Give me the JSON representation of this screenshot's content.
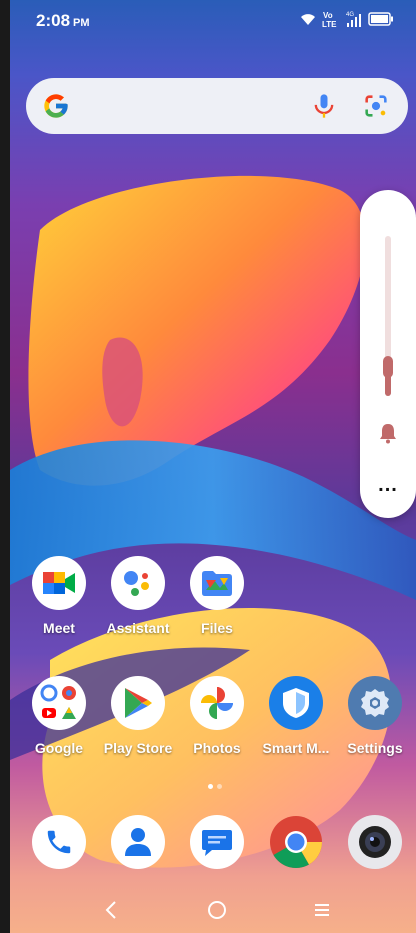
{
  "status_bar": {
    "time": "2:08",
    "meridiem": "PM",
    "icons": [
      "wifi-icon",
      "volte-icon",
      "signal-icon",
      "battery-icon"
    ],
    "volte_text": "Vo",
    "lte_text": "LTE",
    "fourg_text": "4G"
  },
  "search_bar": {
    "icons": [
      "google-logo",
      "mic-icon",
      "lens-icon"
    ]
  },
  "volume_panel": {
    "level": 0.18,
    "icons": [
      "bell-icon",
      "more-icon"
    ],
    "more_label": "..."
  },
  "apps_row1": [
    {
      "label": "Meet",
      "icon": "meet-icon"
    },
    {
      "label": "Assistant",
      "icon": "assistant-icon"
    },
    {
      "label": "Files",
      "icon": "files-icon"
    }
  ],
  "apps_row2": [
    {
      "label": "Google",
      "icon": "google-folder-icon"
    },
    {
      "label": "Play Store",
      "icon": "play-store-icon"
    },
    {
      "label": "Photos",
      "icon": "photos-icon"
    },
    {
      "label": "Smart M...",
      "icon": "smart-manager-icon"
    },
    {
      "label": "Settings",
      "icon": "settings-icon"
    }
  ],
  "dock": [
    {
      "icon": "phone-icon"
    },
    {
      "icon": "contacts-icon"
    },
    {
      "icon": "messages-icon"
    },
    {
      "icon": "chrome-icon"
    },
    {
      "icon": "camera-icon"
    }
  ],
  "page_indicator": {
    "pages": 2,
    "current": 1
  },
  "nav_bar": {
    "icons": [
      "back-icon",
      "home-icon",
      "recents-icon"
    ]
  },
  "colors": {
    "google_blue": "#4285F4",
    "google_red": "#EA4335",
    "google_yellow": "#FBBC05",
    "google_green": "#34A853",
    "volume_accent": "#C06A6A"
  }
}
